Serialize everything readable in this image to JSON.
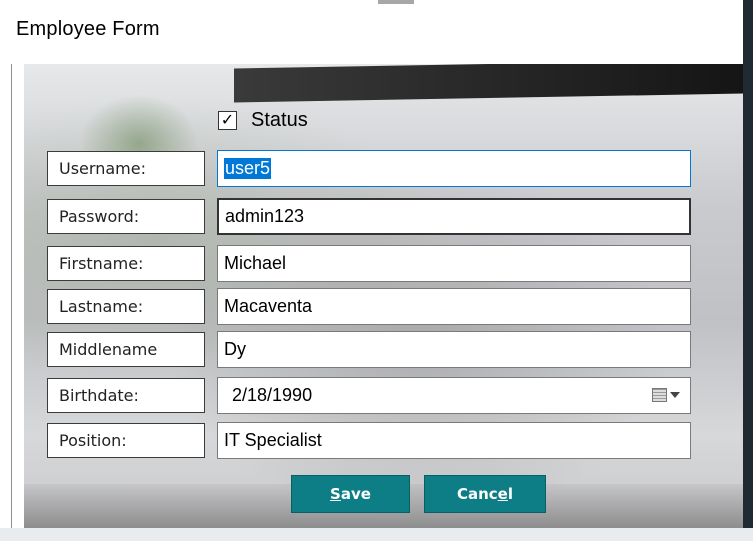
{
  "window": {
    "title": "Employee Form"
  },
  "status": {
    "label": "Status",
    "checked": true,
    "check_glyph": "✓"
  },
  "fields": [
    {
      "key": "username",
      "label": "Username:",
      "value": "user5"
    },
    {
      "key": "password",
      "label": "Password:",
      "value": "admin123"
    },
    {
      "key": "firstname",
      "label": "Firstname:",
      "value": "Michael"
    },
    {
      "key": "lastname",
      "label": "Lastname:",
      "value": "Macaventa"
    },
    {
      "key": "middlename",
      "label": "Middlename",
      "value": "Dy"
    },
    {
      "key": "birthdate",
      "label": "Birthdate:",
      "value": "2/18/1990",
      "icon": "calendar-dropdown-icon"
    },
    {
      "key": "position",
      "label": "Position:",
      "value": "IT Specialist"
    }
  ],
  "buttons": {
    "save": {
      "label_pre": "",
      "mnemonic": "S",
      "label_post": "ave"
    },
    "cancel": {
      "label_pre": "Canc",
      "mnemonic": "e",
      "label_post": "l"
    }
  },
  "colors": {
    "button_bg": "#0d7e86",
    "focus_border": "#0078d7",
    "selection": "#0078d7"
  }
}
